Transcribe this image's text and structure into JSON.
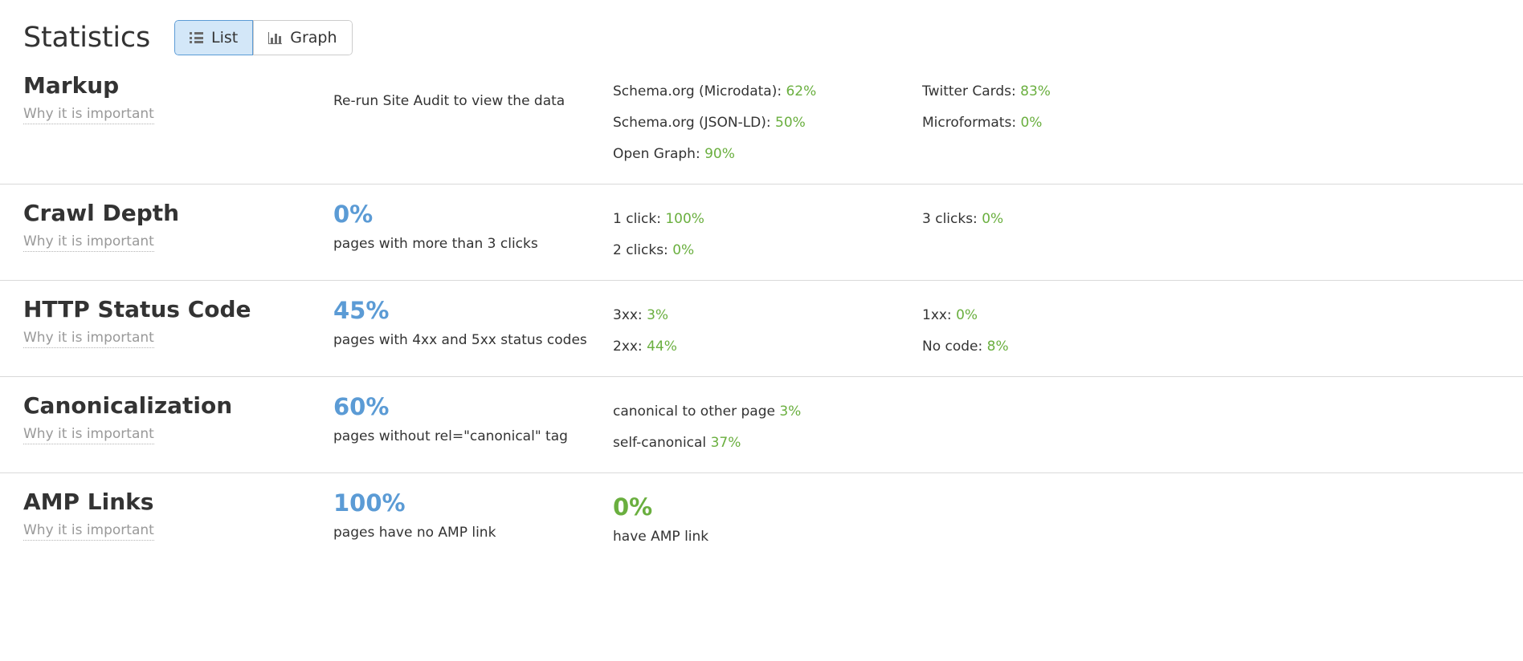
{
  "header": {
    "title": "Statistics",
    "toggle": {
      "options": [
        {
          "label": "List",
          "icon": "list-icon",
          "active": true
        },
        {
          "label": "Graph",
          "icon": "bar-chart-icon",
          "active": false
        }
      ]
    }
  },
  "common": {
    "why_link": "Why it is important"
  },
  "colors": {
    "blue": "#5b9bd5",
    "green": "#6aaf3f",
    "text": "#333333",
    "muted": "#999999",
    "divider": "#d9d9d9",
    "toggle_active_bg": "#d3e7f8",
    "toggle_active_border": "#5b9bd5"
  },
  "rows": [
    {
      "name": "Markup",
      "why": "Why it is important",
      "value": "",
      "value_color": "blue",
      "caption": "",
      "note": "Re-run Site Audit to view the data",
      "details_col1": [
        {
          "label": "Schema.org (Microdata):",
          "value": "62%"
        },
        {
          "label": "Schema.org (JSON-LD):",
          "value": "50%"
        },
        {
          "label": "Open Graph:",
          "value": "90%"
        }
      ],
      "details_col2": [
        {
          "label": "Twitter Cards:",
          "value": "83%"
        },
        {
          "label": "Microformats:",
          "value": "0%"
        }
      ]
    },
    {
      "name": "Crawl Depth",
      "why": "Why it is important",
      "value": "0%",
      "value_color": "blue",
      "caption": "pages with more than 3 clicks",
      "note": "",
      "details_col1": [
        {
          "label": "1 click:",
          "value": "100%"
        },
        {
          "label": "2 clicks:",
          "value": "0%"
        }
      ],
      "details_col2": [
        {
          "label": "3 clicks:",
          "value": "0%"
        }
      ]
    },
    {
      "name": "HTTP Status Code",
      "why": "Why it is important",
      "value": "45%",
      "value_color": "blue",
      "caption": "pages with 4xx and 5xx status codes",
      "note": "",
      "details_col1": [
        {
          "label": "3xx:",
          "value": "3%"
        },
        {
          "label": "2xx:",
          "value": "44%"
        }
      ],
      "details_col2": [
        {
          "label": "1xx:",
          "value": "0%"
        },
        {
          "label": "No code:",
          "value": "8%"
        }
      ]
    },
    {
      "name": "Canonicalization",
      "why": "Why it is important",
      "value": "60%",
      "value_color": "blue",
      "caption": "pages without rel=\"canonical\" tag",
      "note": "",
      "details_col1": [
        {
          "label": "canonical to other page",
          "value": "3%"
        },
        {
          "label": "self-canonical",
          "value": "37%"
        }
      ],
      "details_col2": []
    },
    {
      "name": "AMP Links",
      "why": "Why it is important",
      "value": "100%",
      "value_color": "blue",
      "caption": "pages have no AMP link",
      "note": "",
      "secondary_value": "0%",
      "secondary_value_color": "green",
      "secondary_caption": "have AMP link",
      "details_col1": [],
      "details_col2": []
    }
  ]
}
